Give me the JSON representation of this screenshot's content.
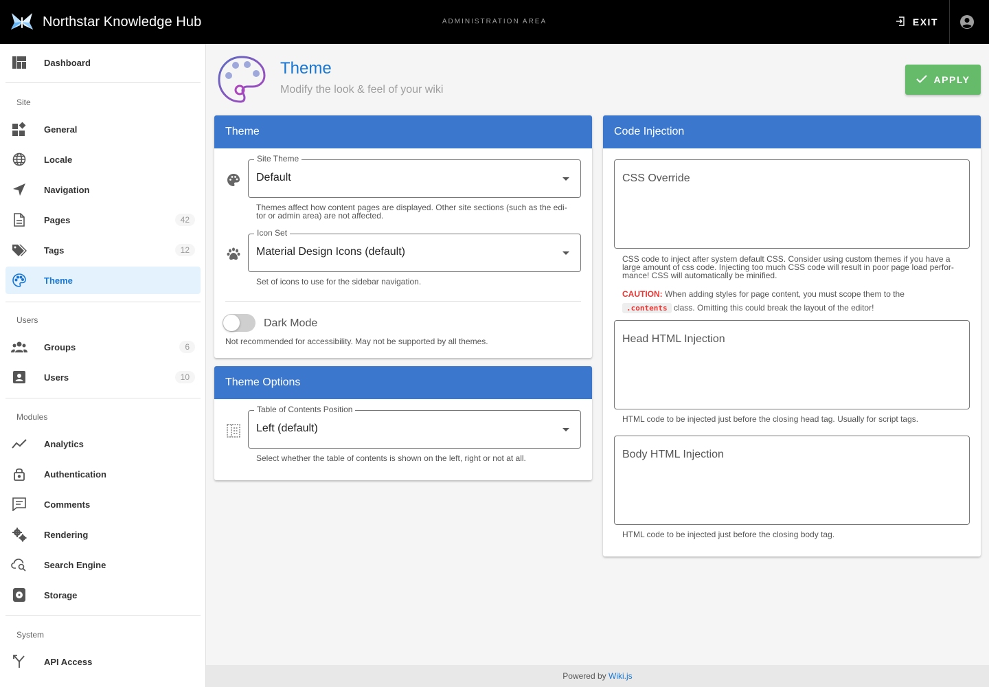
{
  "header": {
    "app_title": "Northstar Knowledge Hub",
    "area_label": "ADMINISTRATION AREA",
    "exit_label": "EXIT"
  },
  "sidebar": {
    "dashboard": "Dashboard",
    "sections": {
      "site": "Site",
      "users": "Users",
      "modules": "Modules",
      "system": "System"
    },
    "site_items": [
      {
        "label": "General",
        "icon": "widgets-icon"
      },
      {
        "label": "Locale",
        "icon": "globe-icon"
      },
      {
        "label": "Navigation",
        "icon": "navigation-arrow-icon"
      },
      {
        "label": "Pages",
        "icon": "file-document-icon",
        "count": "42"
      },
      {
        "label": "Tags",
        "icon": "tags-icon",
        "count": "12"
      },
      {
        "label": "Theme",
        "icon": "palette-icon",
        "active": true
      }
    ],
    "user_items": [
      {
        "label": "Groups",
        "icon": "groups-icon",
        "count": "6"
      },
      {
        "label": "Users",
        "icon": "account-box-icon",
        "count": "10"
      }
    ],
    "module_items": [
      {
        "label": "Analytics",
        "icon": "chart-line-icon"
      },
      {
        "label": "Authentication",
        "icon": "lock-icon"
      },
      {
        "label": "Comments",
        "icon": "comment-icon"
      },
      {
        "label": "Rendering",
        "icon": "cogs-icon"
      },
      {
        "label": "Search Engine",
        "icon": "cloud-search-icon"
      },
      {
        "label": "Storage",
        "icon": "storage-icon"
      }
    ],
    "system_items": [
      {
        "label": "API Access",
        "icon": "api-icon"
      }
    ]
  },
  "page": {
    "title": "Theme",
    "subtitle": "Modify the look & feel of your wiki",
    "apply_label": "APPLY"
  },
  "theme_card": {
    "title": "Theme",
    "site_theme_label": "Site Theme",
    "site_theme_value": "Default",
    "site_theme_hint_1": "Themes affect how content pages are displayed. Other site sections (such as the edi-",
    "site_theme_hint_2": "tor or admin area) are not affected.",
    "icon_set_label": "Icon Set",
    "icon_set_value": "Material Design Icons (default)",
    "icon_set_hint": "Set of icons to use for the sidebar navigation.",
    "dark_mode_label": "Dark Mode",
    "dark_mode_on": false,
    "dark_mode_hint": "Not recommended for accessibility. May not be supported by all themes."
  },
  "theme_options_card": {
    "title": "Theme Options",
    "toc_label": "Table of Contents Position",
    "toc_value": "Left (default)",
    "toc_hint": "Select whether the table of contents is shown on the left, right or not at all."
  },
  "code_card": {
    "title": "Code Injection",
    "css_placeholder": "CSS Override",
    "css_hint_1": "CSS code to inject after system default CSS. Consider using custom themes if you have a",
    "css_hint_2": "large amount of css code. Injecting too much CSS code will result in poor page load perfor-",
    "css_hint_3": "mance! CSS will automatically be minified.",
    "caution_label": "CAUTION:",
    "caution_text_1": "When adding styles for page content, you must scope them to the",
    "caution_code": ".contents",
    "caution_text_2": "class. Omitting this could break the layout of the editor!",
    "head_placeholder": "Head HTML Injection",
    "head_hint": "HTML code to be injected just before the closing head tag. Usually for script tags.",
    "body_placeholder": "Body HTML Injection",
    "body_hint": "HTML code to be injected just before the closing body tag."
  },
  "footer": {
    "powered_by": "Powered by",
    "link_text": "Wiki.js"
  },
  "colors": {
    "primary": "#3b77cd",
    "accent": "#1976d2",
    "apply": "#66bb6a",
    "caution": "#e53935"
  }
}
